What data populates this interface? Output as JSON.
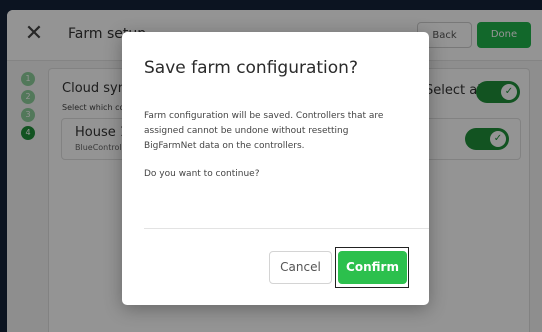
{
  "window": {
    "title": "Farm setup",
    "back_label": "Back",
    "done_label": "Done"
  },
  "steps": [
    "1",
    "2",
    "3",
    "4"
  ],
  "panel": {
    "title": "Cloud sync",
    "subtitle": "Select which controllers",
    "select_all_label": "Select all",
    "select_all_on": true,
    "row": {
      "name": "House 1",
      "sub": "BlueController",
      "enabled": true
    }
  },
  "dialog": {
    "title": "Save farm configuration?",
    "message": "Farm configuration will be saved. Controllers that are assigned cannot be undone without resetting BigFarmNet data on the controllers.",
    "question": "Do you want to continue?",
    "cancel_label": "Cancel",
    "confirm_label": "Confirm"
  },
  "colors": {
    "accent": "#2cc04d",
    "toggle_on": "#1f8f3a",
    "overlay": "rgba(0,0,0,0.42)"
  }
}
